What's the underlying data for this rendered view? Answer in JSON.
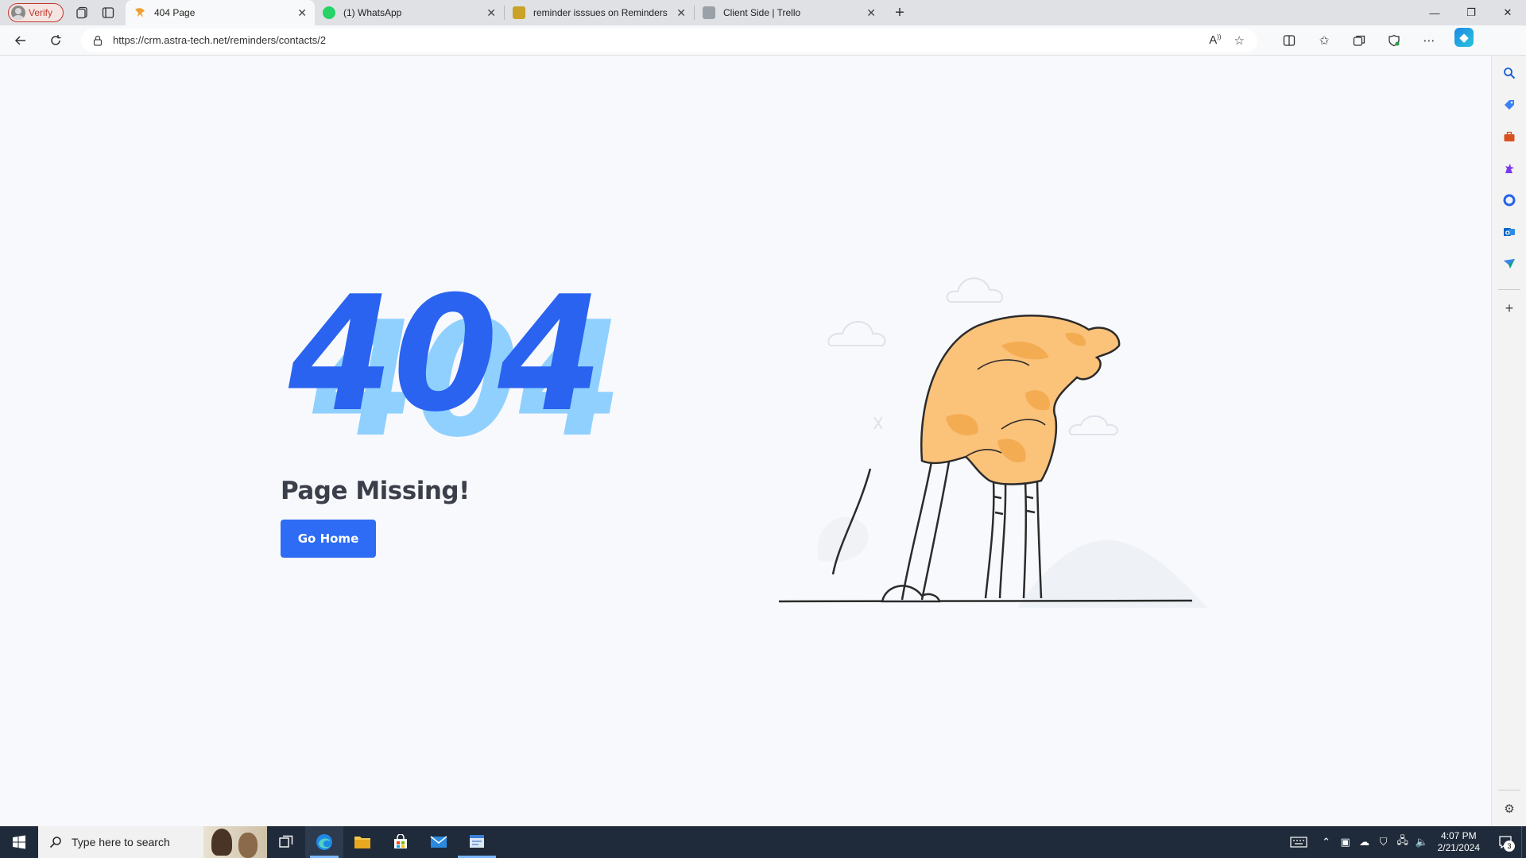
{
  "browser": {
    "profile_label": "Verify",
    "tabs": [
      {
        "title": "404 Page",
        "active": true,
        "favicon_color": "#f0a030"
      },
      {
        "title": "(1) WhatsApp",
        "active": false,
        "favicon_color": "#25d366"
      },
      {
        "title": "reminder isssues on Reminders | Trello",
        "active": false,
        "favicon_color": "#c9a227"
      },
      {
        "title": "Client Side | Trello",
        "active": false,
        "favicon_color": "#9aa0a6"
      }
    ],
    "url": "https://crm.astra-tech.net/reminders/contacts/2"
  },
  "page": {
    "error_code": "404",
    "heading": "Page Missing!",
    "button_label": "Go Home",
    "colors": {
      "accent": "#2e6cf6",
      "code_front": "#2a63f0",
      "code_back": "#8fd0ff",
      "illustration_fill": "#fbc27a"
    }
  },
  "taskbar": {
    "search_placeholder": "Type here to search",
    "time": "4:07 PM",
    "date": "2/21/2024",
    "notification_count": "3"
  }
}
